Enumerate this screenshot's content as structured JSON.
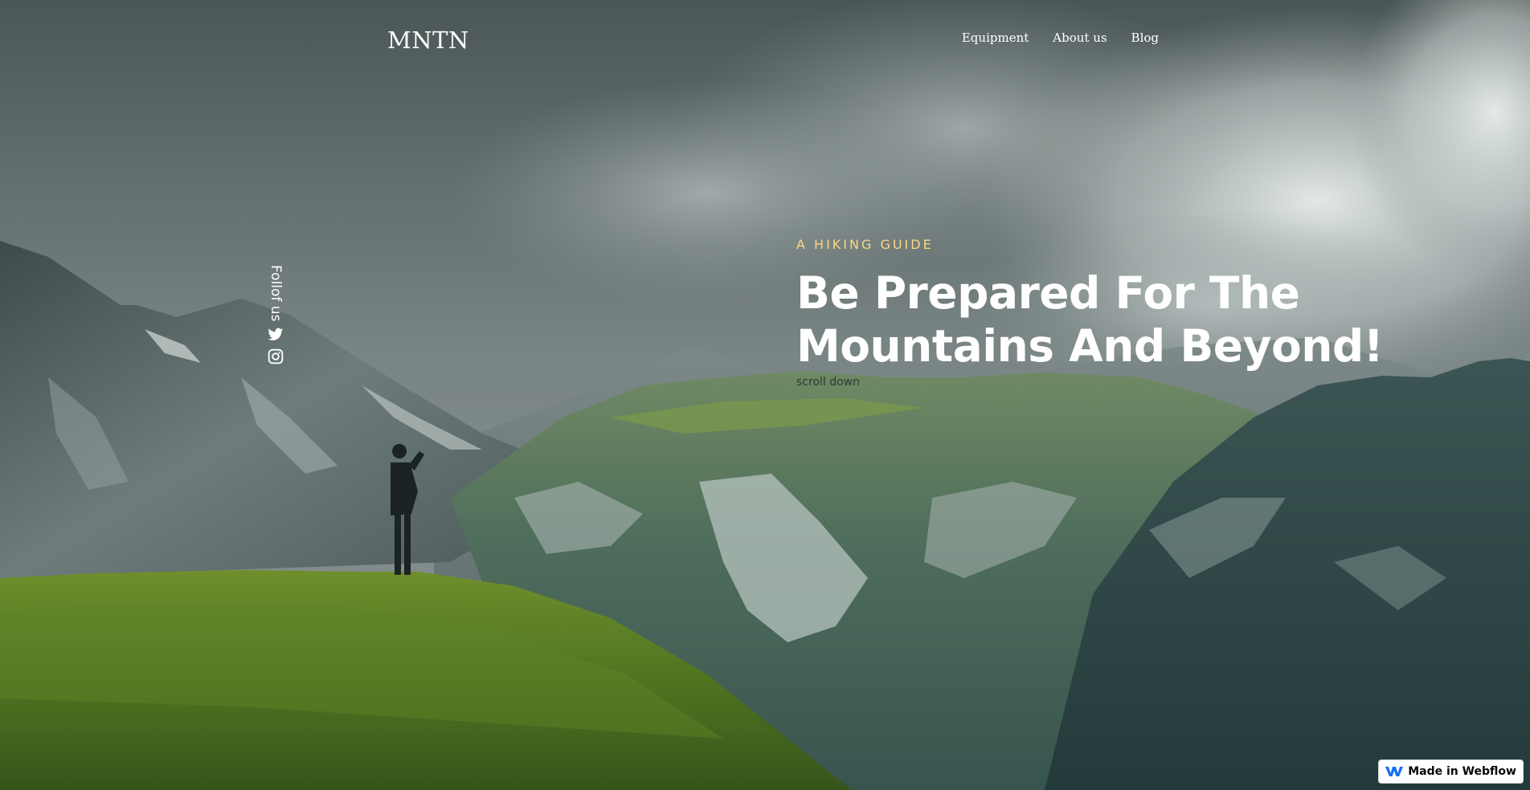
{
  "header": {
    "logo": "MNTN",
    "nav": [
      {
        "label": "Equipment"
      },
      {
        "label": "About us"
      },
      {
        "label": "Blog"
      }
    ]
  },
  "social": {
    "label": "Follof us",
    "icons": [
      "twitter-icon",
      "instagram-icon"
    ]
  },
  "hero": {
    "eyebrow": "A HIKING GUIDE",
    "title_line1": "Be Prepared For The",
    "title_line2": "Mountains And Beyond!",
    "scroll_label": "scroll down"
  },
  "badge": {
    "label": "Made in Webflow",
    "icon": "webflow-icon"
  },
  "colors": {
    "accent": "#FBD784",
    "text": "#FFFFFF"
  }
}
